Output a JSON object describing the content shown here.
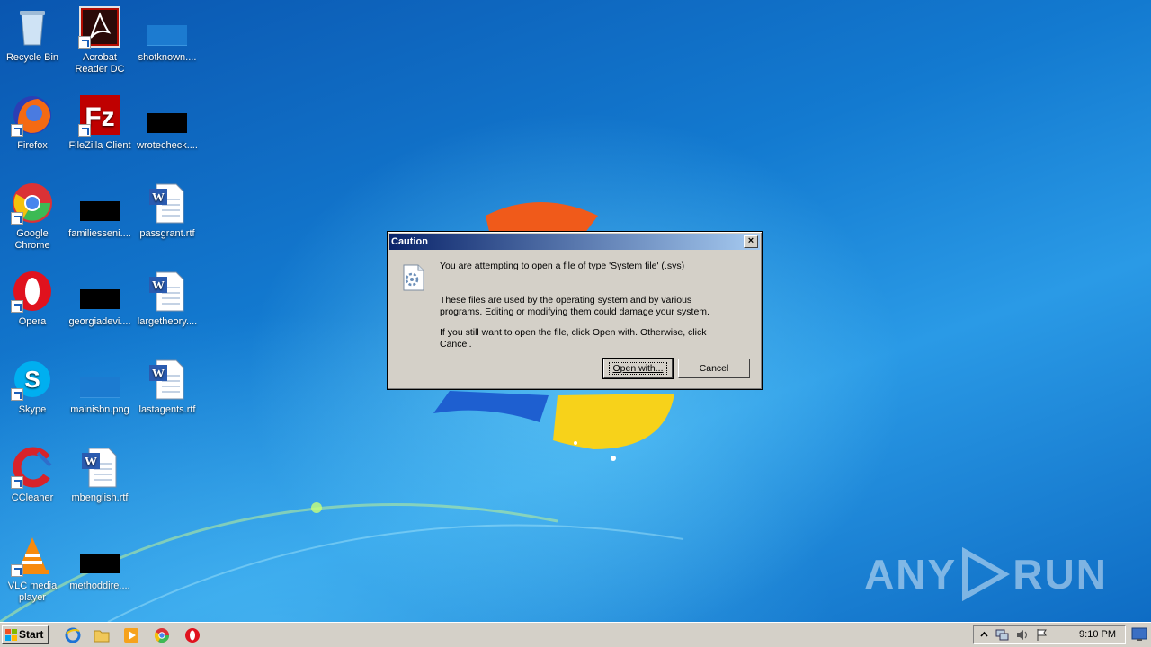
{
  "desktop": {
    "icons": [
      {
        "label": "Recycle Bin",
        "icon": "recycle-bin-icon"
      },
      {
        "label": "Acrobat Reader DC",
        "icon": "acrobat-icon"
      },
      {
        "label": "shotknown....",
        "icon": "image-file-icon"
      },
      {
        "label": "Firefox",
        "icon": "firefox-icon"
      },
      {
        "label": "FileZilla Client",
        "icon": "filezilla-icon"
      },
      {
        "label": "wrotecheck....",
        "icon": "image-file-icon"
      },
      {
        "label": "Google Chrome",
        "icon": "chrome-icon"
      },
      {
        "label": "familiesseni....",
        "icon": "image-file-icon"
      },
      {
        "label": "passgrant.rtf",
        "icon": "word-document-icon"
      },
      {
        "label": "Opera",
        "icon": "opera-icon"
      },
      {
        "label": "georgiadevi....",
        "icon": "image-file-icon"
      },
      {
        "label": "largetheory....",
        "icon": "word-document-icon"
      },
      {
        "label": "Skype",
        "icon": "skype-icon"
      },
      {
        "label": "mainisbn.png",
        "icon": "image-file-icon"
      },
      {
        "label": "lastagents.rtf",
        "icon": "word-document-icon"
      },
      {
        "label": "CCleaner",
        "icon": "ccleaner-icon"
      },
      {
        "label": "mbenglish.rtf",
        "icon": "word-document-icon"
      },
      {
        "label": "VLC media player",
        "icon": "vlc-icon"
      },
      {
        "label": "methoddire....",
        "icon": "image-file-icon"
      }
    ]
  },
  "dialog": {
    "title": "Caution",
    "line1": "You are attempting to open a file of type 'System file' (.sys)",
    "line2": "These files are used by the operating system and by various programs. Editing or modifying them could damage your system.",
    "line3": "If you still want to open the file, click Open with. Otherwise, click Cancel.",
    "open_with_label": "Open with...",
    "cancel_label": "Cancel",
    "close_label": "×"
  },
  "watermark": {
    "text_left": "ANY",
    "text_right": "RUN"
  },
  "taskbar": {
    "start_label": "Start",
    "quick_launch": [
      "internet-explorer-icon",
      "folder-icon",
      "media-player-icon",
      "chrome-icon",
      "opera-icon"
    ],
    "clock": "9:10 PM"
  },
  "colors": {
    "titlebar_start": "#0a246a",
    "titlebar_end": "#a6caf0",
    "dialog_bg": "#d4d0c8"
  }
}
